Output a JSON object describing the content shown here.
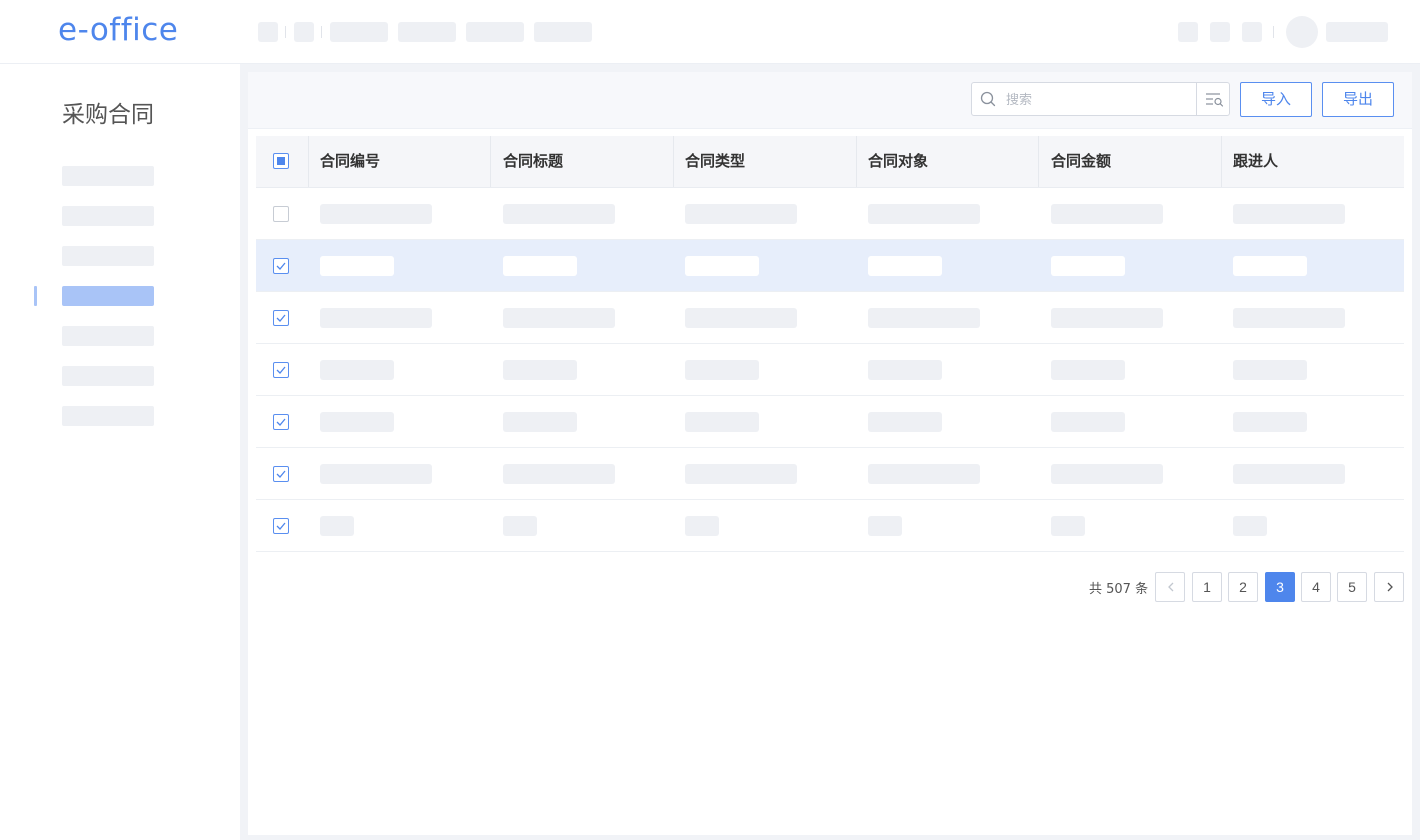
{
  "header": {
    "logo": "e-office"
  },
  "sidebar": {
    "title": "采购合同",
    "active_index": 3
  },
  "toolbar": {
    "search_placeholder": "搜索",
    "import_label": "导入",
    "export_label": "导出"
  },
  "table": {
    "columns": [
      "合同编号",
      "合同标题",
      "合同类型",
      "合同对象",
      "合同金额",
      "跟进人"
    ],
    "rows": [
      {
        "checked": false,
        "selected": false
      },
      {
        "checked": true,
        "selected": true
      },
      {
        "checked": true,
        "selected": false
      },
      {
        "checked": true,
        "selected": false
      },
      {
        "checked": true,
        "selected": false
      },
      {
        "checked": true,
        "selected": false
      },
      {
        "checked": true,
        "selected": false
      }
    ]
  },
  "pagination": {
    "total_text": "共 507 条",
    "pages": [
      "1",
      "2",
      "3",
      "4",
      "5"
    ],
    "current": "3"
  },
  "colors": {
    "accent": "#4e86ec",
    "selected_row": "#e7eefb",
    "placeholder": "#eef0f4"
  },
  "icons": [
    "search-icon",
    "advanced-search-icon",
    "chevron-left-icon",
    "chevron-right-icon",
    "checkbox-icon"
  ]
}
